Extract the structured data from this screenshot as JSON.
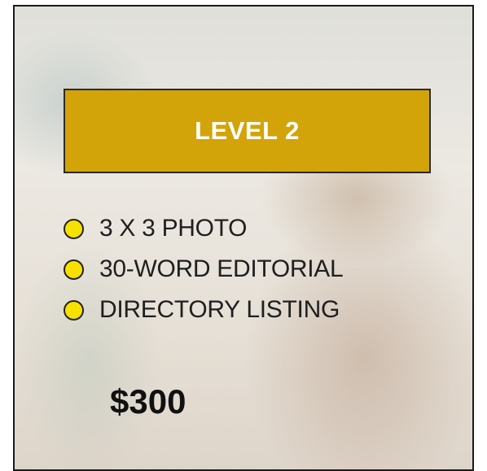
{
  "banner": {
    "title": "LEVEL 2",
    "color": "#d3a40a"
  },
  "features": [
    {
      "label": "3 X 3 PHOTO",
      "icon": "yellow-circle-bullet-icon"
    },
    {
      "label": "30-WORD EDITORIAL",
      "icon": "yellow-circle-bullet-icon"
    },
    {
      "label": "DIRECTORY LISTING",
      "icon": "yellow-circle-bullet-icon"
    }
  ],
  "price": "$300",
  "colors": {
    "bullet": "#f7e100",
    "banner_text": "#ffffff"
  }
}
